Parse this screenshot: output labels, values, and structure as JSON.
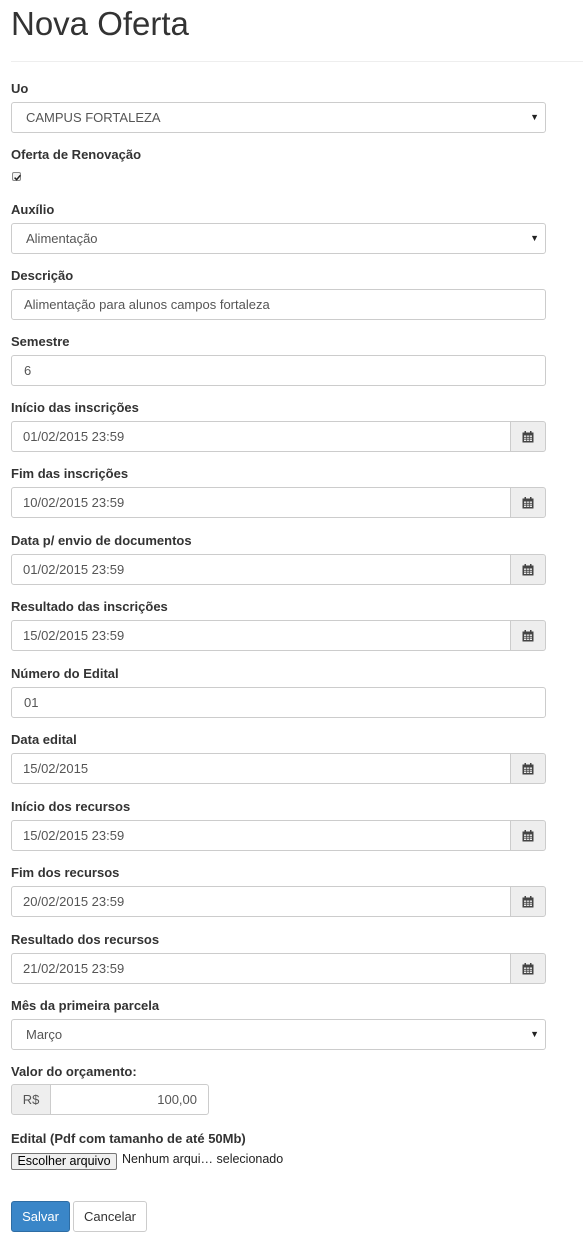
{
  "page": {
    "title": "Nova Oferta"
  },
  "uo": {
    "label": "Uo",
    "value": "CAMPUS FORTALEZA"
  },
  "renovacao": {
    "label": "Oferta de Renovação",
    "checked": true
  },
  "auxilio": {
    "label": "Auxílio",
    "value": "Alimentação"
  },
  "descricao": {
    "label": "Descrição",
    "value": "Alimentação para alunos campos fortaleza"
  },
  "semestre": {
    "label": "Semestre",
    "value": "6"
  },
  "inicio_inscricoes": {
    "label": "Início das inscrições",
    "value": "01/02/2015 23:59"
  },
  "fim_inscricoes": {
    "label": "Fim das inscrições",
    "value": "10/02/2015 23:59"
  },
  "envio_documentos": {
    "label": "Data p/ envio de documentos",
    "value": "01/02/2015 23:59"
  },
  "resultado_inscricoes": {
    "label": "Resultado das inscrições",
    "value": "15/02/2015 23:59"
  },
  "numero_edital": {
    "label": "Número do Edital",
    "value": "01"
  },
  "data_edital": {
    "label": "Data edital",
    "value": "15/02/2015"
  },
  "inicio_recursos": {
    "label": "Início dos recursos",
    "value": "15/02/2015 23:59"
  },
  "fim_recursos": {
    "label": "Fim dos recursos",
    "value": "20/02/2015 23:59"
  },
  "resultado_recursos": {
    "label": "Resultado dos recursos",
    "value": "21/02/2015 23:59"
  },
  "mes_parcela": {
    "label": "Mês da primeira parcela",
    "value": "Março"
  },
  "orcamento": {
    "label": "Valor do orçamento:",
    "prefix": "R$",
    "value": "100,00"
  },
  "edital_file": {
    "label": "Edital (Pdf com tamanho de até 50Mb)",
    "button": "Escolher arquivo",
    "status": "Nenhum arqui… selecionado"
  },
  "actions": {
    "save": "Salvar",
    "cancel": "Cancelar"
  },
  "colors": {
    "primary": "#3a86c8",
    "addon_bg": "#eeeeee",
    "border": "#cccccc"
  },
  "icons": {
    "calendar": "calendar-icon",
    "caret": "chevron-down-icon",
    "check": "check-icon"
  }
}
